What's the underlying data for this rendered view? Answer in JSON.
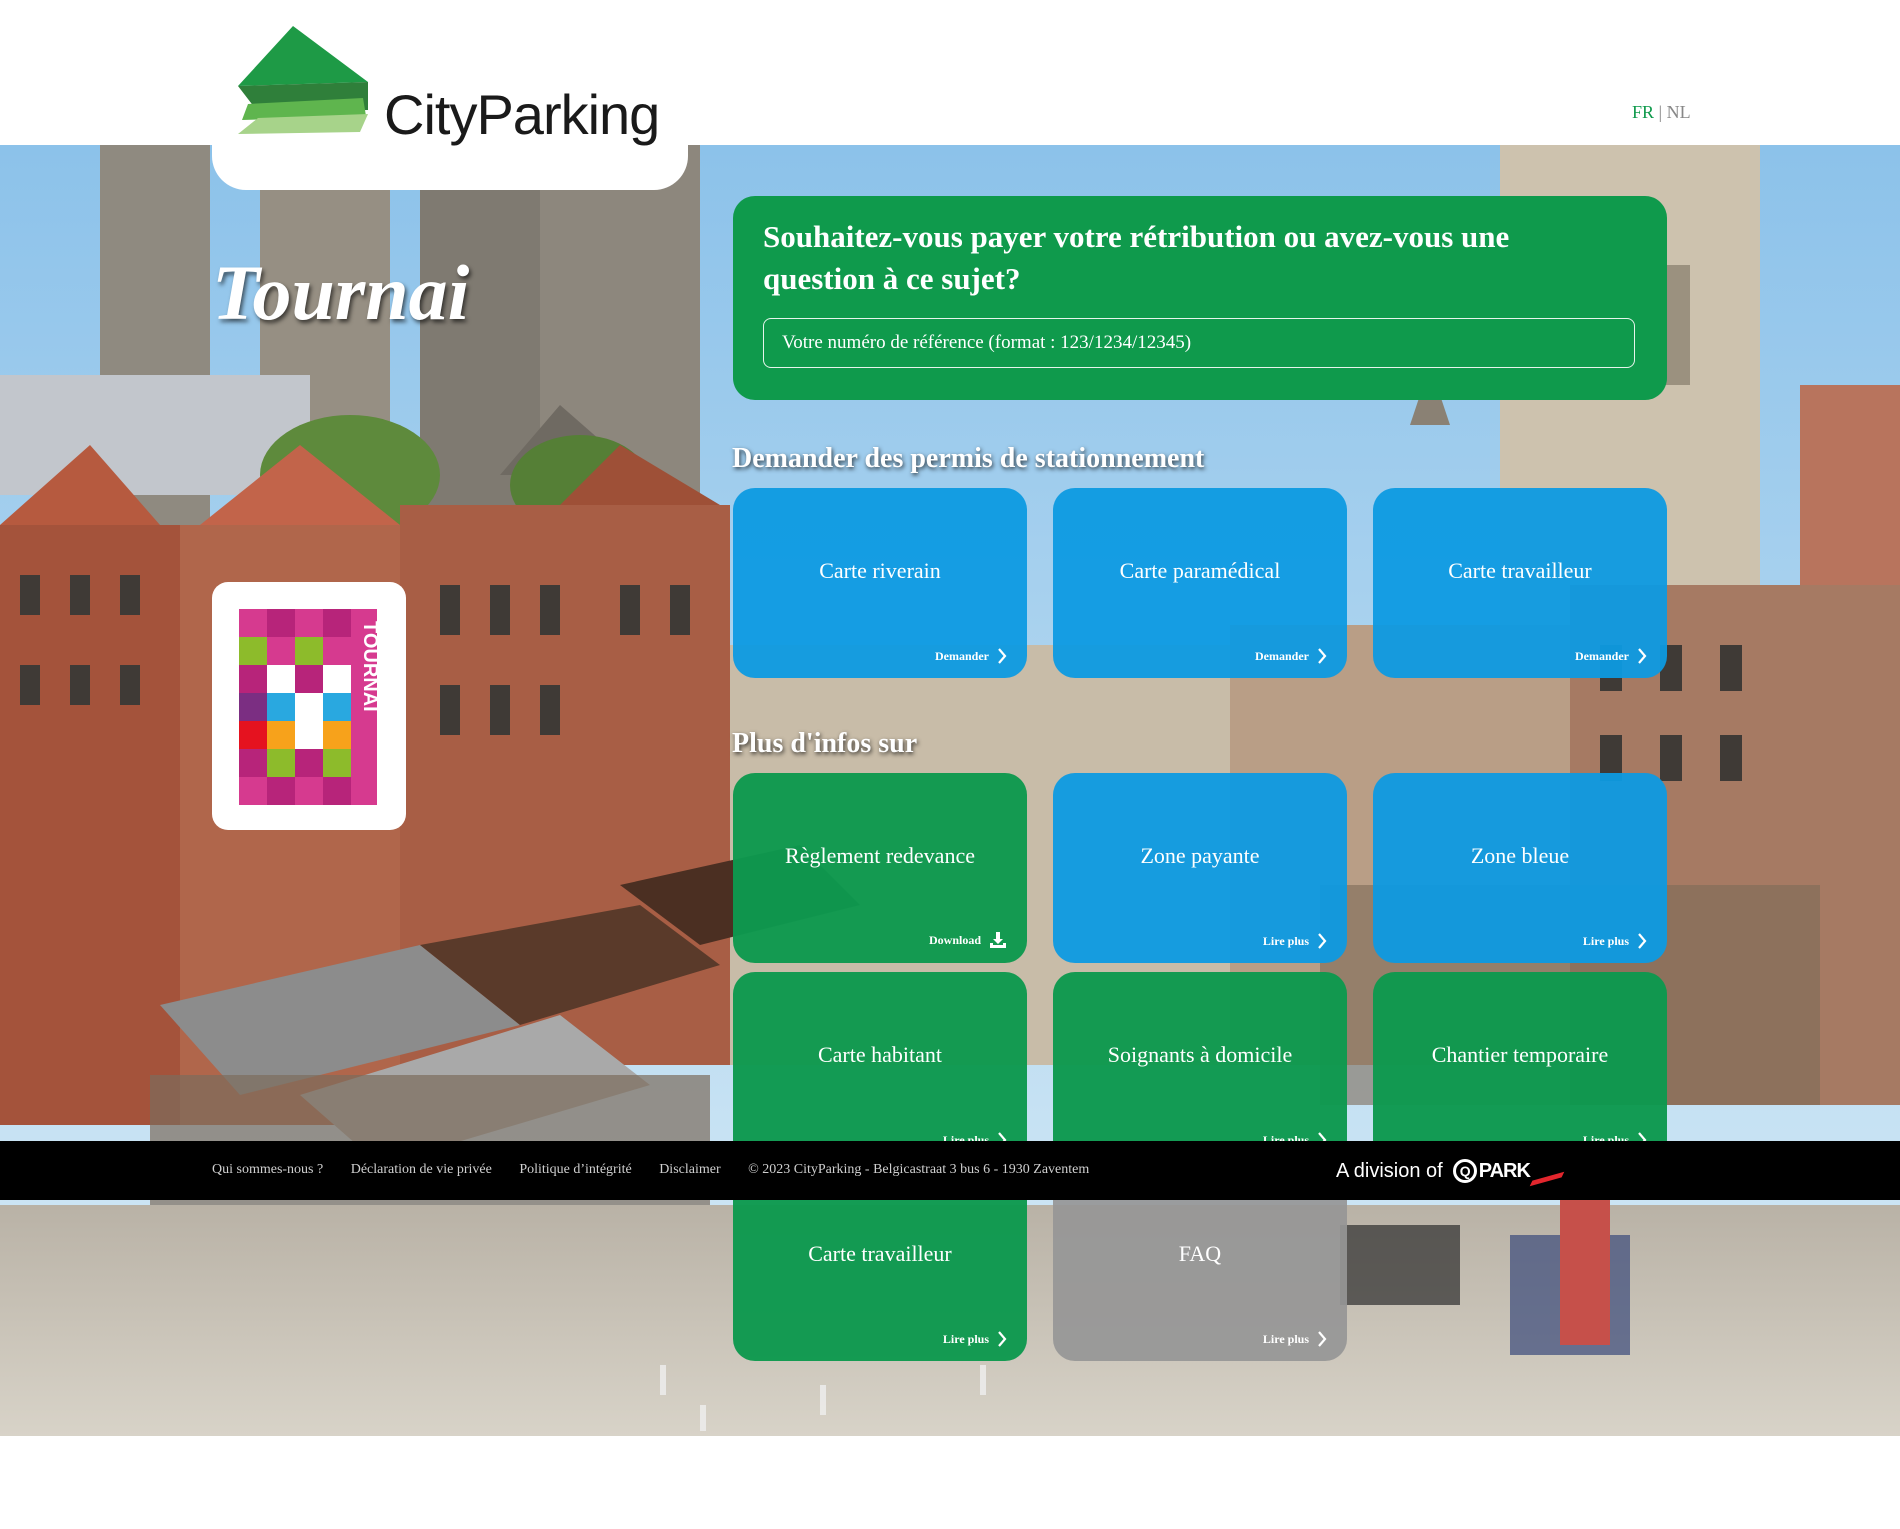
{
  "header": {
    "logo_text": "CityParking",
    "lang": {
      "fr": "FR",
      "separator": "|",
      "nl": "NL",
      "active": "FR"
    }
  },
  "hero": {
    "city_title": "Tournai",
    "city_logo_text": "TOURNAI"
  },
  "payment": {
    "title": "Souhaitez-vous payer votre rétribution ou avez-vous une question à ce sujet?",
    "placeholder": "Votre numéro de référence (format : 123/1234/12345)"
  },
  "permits": {
    "title": "Demander des permis de stationnement",
    "tiles": [
      {
        "label": "Carte riverain",
        "action": "Demander",
        "icon": "chevron-right-icon",
        "color": "blue"
      },
      {
        "label": "Carte paramédical",
        "action": "Demander",
        "icon": "chevron-right-icon",
        "color": "blue"
      },
      {
        "label": "Carte travailleur",
        "action": "Demander",
        "icon": "chevron-right-icon",
        "color": "blue"
      }
    ]
  },
  "info": {
    "title": "Plus d'infos sur",
    "tiles": [
      {
        "label": "Règlement redevance",
        "action": "Download",
        "icon": "download-icon",
        "color": "green"
      },
      {
        "label": "Zone payante",
        "action": "Lire plus",
        "icon": "chevron-right-icon",
        "color": "blue"
      },
      {
        "label": "Zone bleue",
        "action": "Lire plus",
        "icon": "chevron-right-icon",
        "color": "blue"
      },
      {
        "label": "Carte habitant",
        "action": "Lire plus",
        "icon": "chevron-right-icon",
        "color": "green"
      },
      {
        "label": "Soignants à domicile",
        "action": "Lire plus",
        "icon": "chevron-right-icon",
        "color": "green"
      },
      {
        "label": "Chantier temporaire",
        "action": "Lire plus",
        "icon": "chevron-right-icon",
        "color": "green"
      },
      {
        "label": "Carte travailleur",
        "action": "Lire plus",
        "icon": "chevron-right-icon",
        "color": "green"
      },
      {
        "label": "FAQ",
        "action": "Lire plus",
        "icon": "chevron-right-icon",
        "color": "grey"
      }
    ]
  },
  "footer": {
    "links": [
      "Qui sommes-nous ?",
      "Déclaration de vie privée",
      "Politique d’intégrité",
      "Disclaimer"
    ],
    "copyright": "© 2023 CityParking - Belgicastraat 3 bus 6 - 1930 Zaventem",
    "division_text": "A division of",
    "division_brand": "PARK"
  },
  "colors": {
    "green": "#0f9a4c",
    "blue": "#0d9ae1",
    "grey": "#969696",
    "footer": "#000000"
  }
}
